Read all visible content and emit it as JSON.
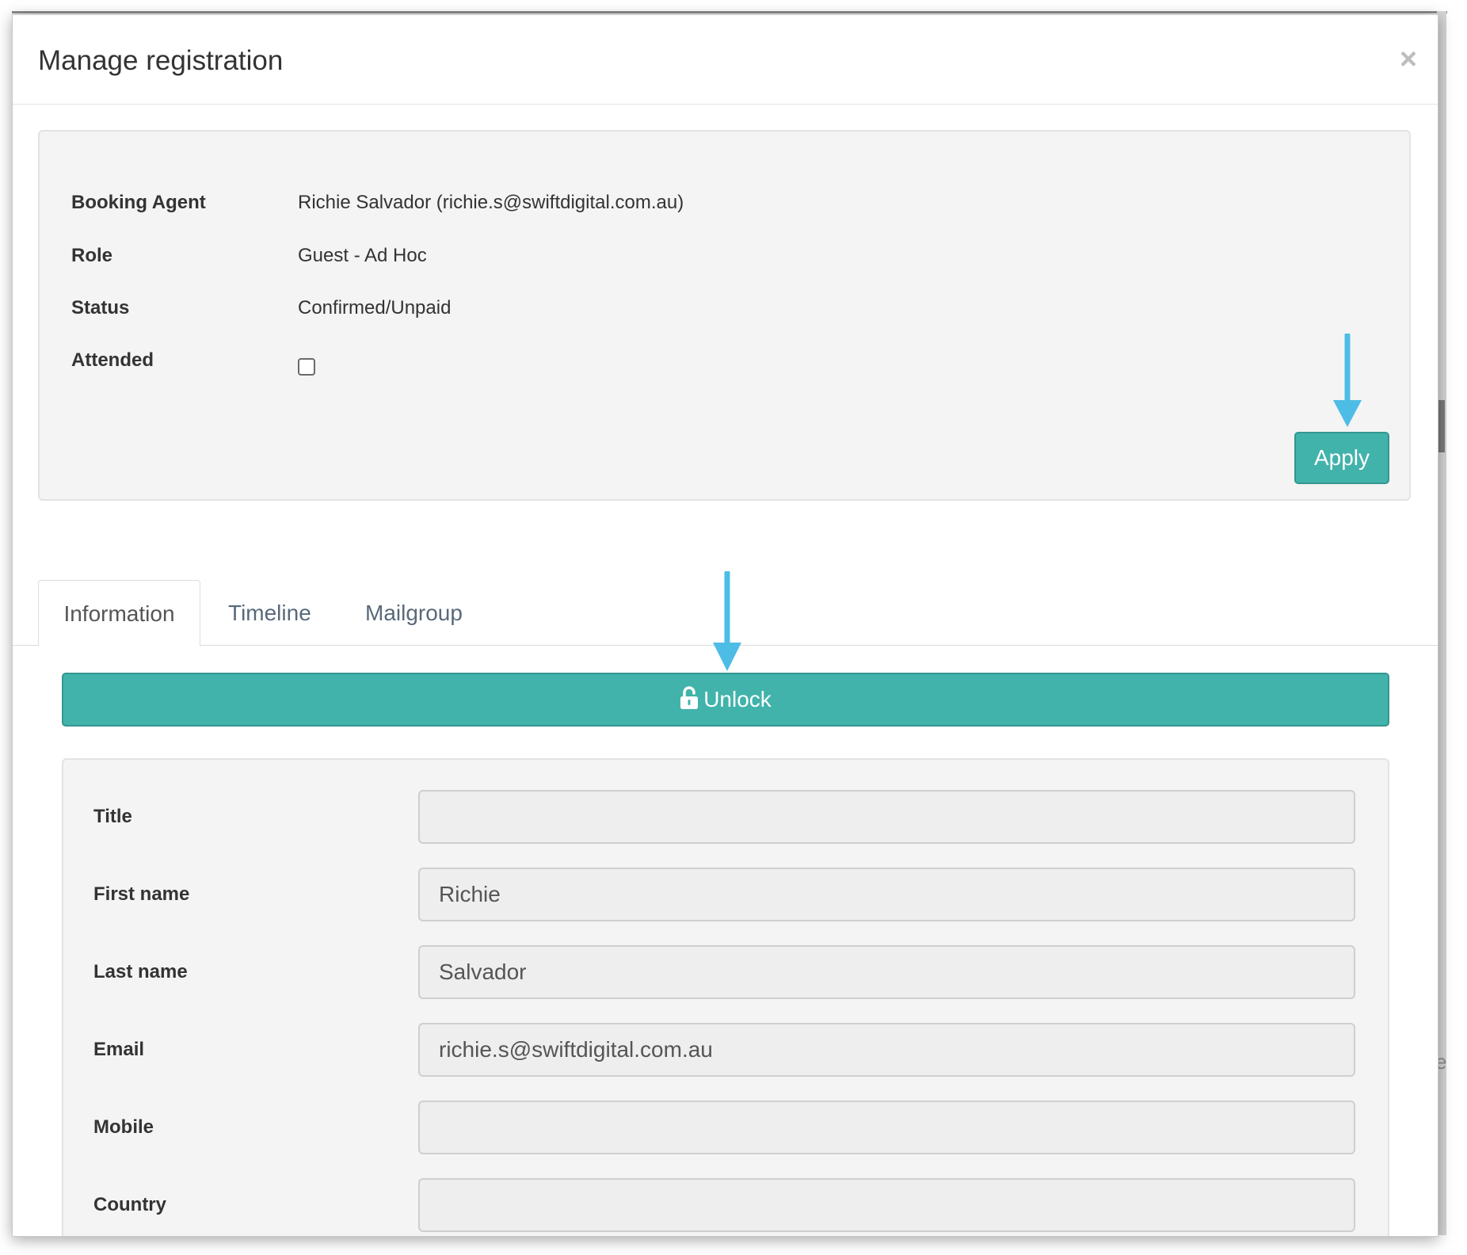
{
  "modal": {
    "title": "Manage registration",
    "close_glyph": "×"
  },
  "summary": {
    "rows": [
      {
        "label": "Booking Agent",
        "value": "Richie Salvador (richie.s@swiftdigital.com.au)"
      },
      {
        "label": "Role",
        "value": "Guest - Ad Hoc"
      },
      {
        "label": "Status",
        "value": "Confirmed/Unpaid"
      },
      {
        "label": "Attended",
        "checked": false
      }
    ],
    "apply_label": "Apply"
  },
  "tabs": [
    {
      "label": "Information",
      "active": true
    },
    {
      "label": "Timeline",
      "active": false
    },
    {
      "label": "Mailgroup",
      "active": false
    }
  ],
  "unlock": {
    "label": "Unlock",
    "icon": "unlock-icon"
  },
  "form": {
    "fields": [
      {
        "label": "Title",
        "value": ""
      },
      {
        "label": "First name",
        "value": "Richie"
      },
      {
        "label": "Last name",
        "value": "Salvador"
      },
      {
        "label": "Email",
        "value": "richie.s@swiftdigital.com.au"
      },
      {
        "label": "Mobile",
        "value": ""
      },
      {
        "label": "Country",
        "value": ""
      }
    ]
  },
  "annotation": {
    "arrow_color": "#4dbde6"
  },
  "colors": {
    "accent": "#41b3ab",
    "panel_bg": "#f4f4f4",
    "input_bg": "#eeeeee"
  }
}
